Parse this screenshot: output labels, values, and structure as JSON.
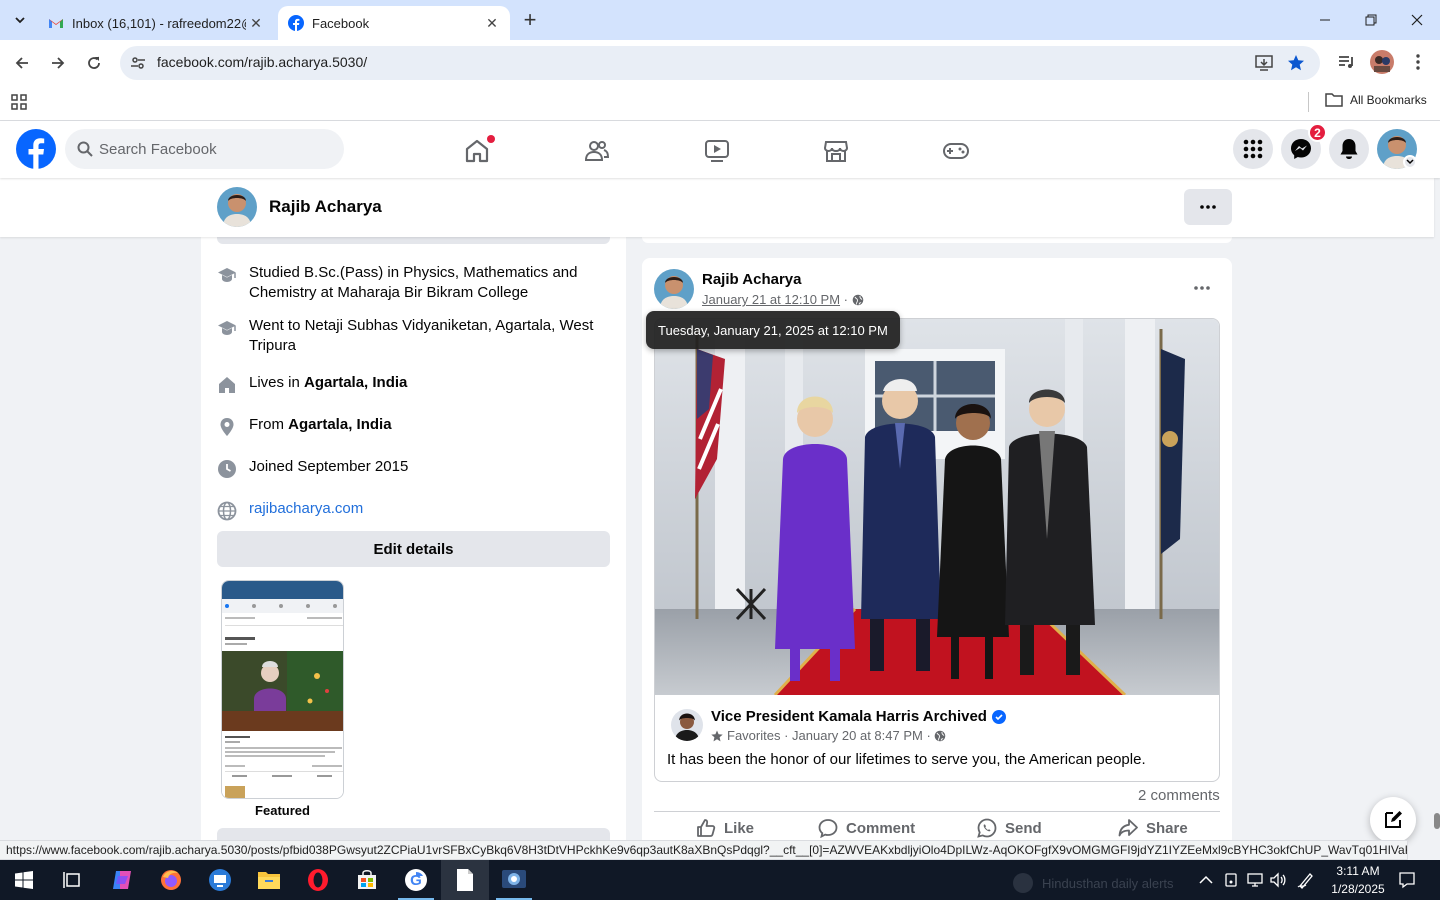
{
  "browser": {
    "tabs": [
      {
        "title": "Inbox (16,101) - rafreedom22@",
        "icon": "gmail-icon",
        "active": false
      },
      {
        "title": "Facebook",
        "icon": "facebook-icon",
        "active": true
      }
    ],
    "url": "facebook.com/rajib.acharya.5030/",
    "bookmarks_all": "All Bookmarks",
    "status_url": "https://www.facebook.com/rajib.acharya.5030/posts/pfbid038PGwsyut2ZCPiaU1vrSFBxCyBkq6V8H3tDtVHPckhKe9v6qp3autK8aXBnQsPdqgl?__cft__[0]=AZWVEAKxbdljyiOlo4DpILWz-AqOKOFgfX9vOMGMGFI9jdYZ1IYZEeMxl9cBYHC3okfChUP_WavTq01HIVaKPRrW..."
  },
  "facebook": {
    "search_placeholder": "Search Facebook",
    "messenger_badge": "2",
    "brand_color": "#0866ff"
  },
  "profile": {
    "name": "Rajib Acharya"
  },
  "intro": {
    "items": [
      {
        "icon": "graduation-cap-icon",
        "text": "Studied B.Sc.(Pass) in Physics, Mathematics and Chemistry at Maharaja Bir Bikram College"
      },
      {
        "icon": "graduation-cap-icon",
        "text": "Went to Netaji Subhas Vidyaniketan, Agartala, West Tripura"
      },
      {
        "icon": "home-icon",
        "prefix": "Lives in ",
        "bold": "Agartala, India"
      },
      {
        "icon": "location-pin-icon",
        "prefix": "From ",
        "bold": "Agartala, India"
      },
      {
        "icon": "clock-icon",
        "text": "Joined September 2015"
      },
      {
        "icon": "globe-icon",
        "link": "rajibacharya.com"
      }
    ],
    "edit_label": "Edit details",
    "featured_label": "Featured"
  },
  "post": {
    "author": "Rajib Acharya",
    "date": "January 21 at 12:10 PM",
    "tooltip": "Tuesday, January 21, 2025 at 12:10 PM",
    "shared": {
      "page_name": "Vice President Kamala Harris Archived",
      "list": "Favorites",
      "date": "January 20 at 8:47 PM",
      "text": "It has been the honor of our lifetimes to serve you, the American people."
    },
    "comments_count": "2 comments",
    "actions": {
      "like": "Like",
      "comment": "Comment",
      "send": "Send",
      "share": "Share"
    }
  },
  "taskbar": {
    "ghost_text": "Hindusthan daily alerts",
    "time": "3:11 AM",
    "date": "1/28/2025"
  }
}
